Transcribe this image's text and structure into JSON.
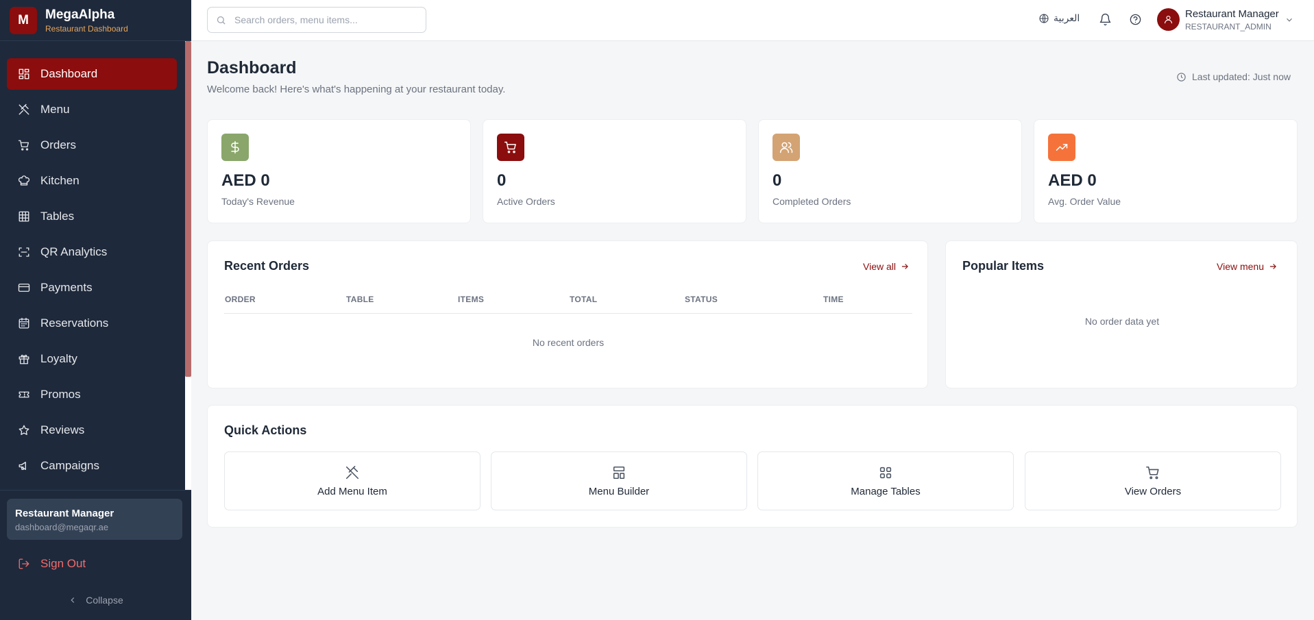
{
  "brand": {
    "letter": "M",
    "name": "MegaAlpha",
    "subtitle": "Restaurant Dashboard"
  },
  "sidebar": {
    "items": [
      {
        "label": "Dashboard",
        "icon": "dashboard-icon",
        "active": true
      },
      {
        "label": "Menu",
        "icon": "utensils-icon"
      },
      {
        "label": "Orders",
        "icon": "cart-icon"
      },
      {
        "label": "Kitchen",
        "icon": "chef-hat-icon"
      },
      {
        "label": "Tables",
        "icon": "table-grid-icon"
      },
      {
        "label": "QR Analytics",
        "icon": "qr-scan-icon"
      },
      {
        "label": "Payments",
        "icon": "credit-card-icon"
      },
      {
        "label": "Reservations",
        "icon": "calendar-icon"
      },
      {
        "label": "Loyalty",
        "icon": "gift-icon"
      },
      {
        "label": "Promos",
        "icon": "ticket-icon"
      },
      {
        "label": "Reviews",
        "icon": "star-icon"
      },
      {
        "label": "Campaigns",
        "icon": "megaphone-icon"
      }
    ],
    "user": {
      "name": "Restaurant Manager",
      "email": "dashboard@megaqr.ae"
    },
    "sign_out": "Sign Out",
    "collapse": "Collapse"
  },
  "topbar": {
    "search_placeholder": "Search orders, menu items...",
    "language": "العربية",
    "user_name": "Restaurant Manager",
    "user_role": "RESTAURANT_ADMIN"
  },
  "header": {
    "title": "Dashboard",
    "subtitle": "Welcome back! Here's what's happening at your restaurant today.",
    "last_updated": "Last updated: Just now"
  },
  "stats": [
    {
      "value": "AED 0",
      "label": "Today's Revenue",
      "icon": "dollar-icon",
      "color": "#8aa66a"
    },
    {
      "value": "0",
      "label": "Active Orders",
      "icon": "cart-icon",
      "color": "#8b0d0d"
    },
    {
      "value": "0",
      "label": "Completed Orders",
      "icon": "users-icon",
      "color": "#d4a373"
    },
    {
      "value": "AED 0",
      "label": "Avg. Order Value",
      "icon": "trending-up-icon",
      "color": "#f5733a"
    }
  ],
  "recent_orders": {
    "title": "Recent Orders",
    "link": "View all",
    "columns": [
      "ORDER",
      "TABLE",
      "ITEMS",
      "TOTAL",
      "STATUS",
      "TIME"
    ],
    "empty": "No recent orders"
  },
  "popular_items": {
    "title": "Popular Items",
    "link": "View menu",
    "empty": "No order data yet"
  },
  "quick_actions": {
    "title": "Quick Actions",
    "buttons": [
      {
        "label": "Add Menu Item",
        "icon": "utensils-icon"
      },
      {
        "label": "Menu Builder",
        "icon": "layout-icon"
      },
      {
        "label": "Manage Tables",
        "icon": "grid-icon"
      },
      {
        "label": "View Orders",
        "icon": "cart-icon"
      }
    ]
  },
  "colors": {
    "accent": "#8b0d0d",
    "sidebar": "#1e293b",
    "brand_subtitle": "#e6a65d",
    "sign_out": "#f26b6b"
  }
}
